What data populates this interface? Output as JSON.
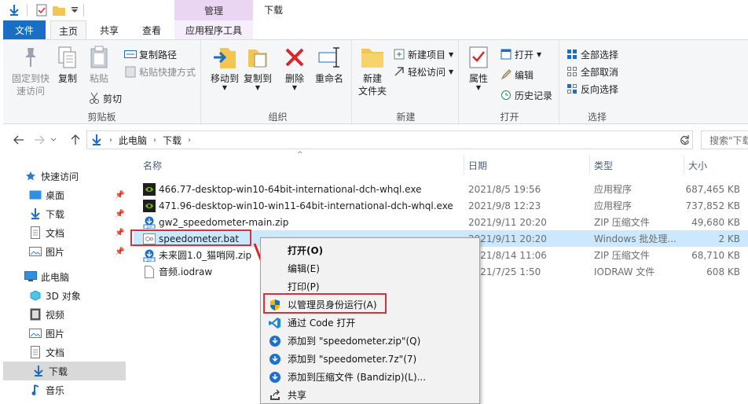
{
  "window": {
    "context_group": "管理",
    "title": "下载"
  },
  "tabs": {
    "file": "文件",
    "home": "主页",
    "share": "共享",
    "view": "查看",
    "app_tools": "应用程序工具"
  },
  "ribbon": {
    "clipboard": {
      "label": "剪贴板",
      "pin_quick_access": "固定到快\n速访问",
      "copy": "复制",
      "paste": "粘贴",
      "copy_path": "复制路径",
      "paste_shortcut": "粘贴快捷方式",
      "cut": "剪切"
    },
    "organize": {
      "label": "组织",
      "move_to": "移动到",
      "copy_to": "复制到",
      "delete": "删除",
      "rename": "重命名"
    },
    "new": {
      "label": "新建",
      "new_folder": "新建\n文件夹",
      "new_item": "新建项目",
      "easy_access": "轻松访问"
    },
    "open": {
      "label": "打开",
      "properties": "属性",
      "open": "打开",
      "edit": "编辑",
      "history": "历史记录"
    },
    "select": {
      "label": "选择",
      "select_all": "全部选择",
      "select_none": "全部取消",
      "invert": "反向选择"
    }
  },
  "address": {
    "path": [
      "此电脑",
      "下载"
    ],
    "search_placeholder": "搜索\"下载"
  },
  "navpane": {
    "quick_access": "快速访问",
    "items": [
      "桌面",
      "下载",
      "文档",
      "图片"
    ],
    "this_pc": "此电脑",
    "pc_items": [
      "3D 对象",
      "视频",
      "图片",
      "文档",
      "下载",
      "音乐"
    ]
  },
  "columns": {
    "name": "名称",
    "date": "日期",
    "type": "类型",
    "size": "大小"
  },
  "files": [
    {
      "name": "466.77-desktop-win10-64bit-international-dch-whql.exe",
      "date": "2021/8/5 19:56",
      "type": "应用程序",
      "size": "687,465 KB",
      "icon": "nvidia-exe-icon"
    },
    {
      "name": "471.96-desktop-win10-win11-64bit-international-dch-whql.exe",
      "date": "2021/9/8 12:23",
      "type": "应用程序",
      "size": "737,852 KB",
      "icon": "nvidia-exe-icon"
    },
    {
      "name": "gw2_speedometer-main.zip",
      "date": "2021/9/11 20:20",
      "type": "ZIP 压缩文件",
      "size": "49,680 KB",
      "icon": "zip-icon"
    },
    {
      "name": "speedometer.bat",
      "date": "2021/9/11 20:20",
      "type": "Windows 批处理...",
      "size": "2 KB",
      "icon": "bat-icon"
    },
    {
      "name": "未来圆1.0_猫哨网.zip",
      "date": "2021/8/14 11:06",
      "type": "ZIP 压缩文件",
      "size": "68,710 KB",
      "icon": "zip-icon"
    },
    {
      "name": "音频.iodraw",
      "date": "2021/7/25 1:50",
      "type": "IODRAW 文件",
      "size": "608 KB",
      "icon": "file-icon"
    }
  ],
  "context_menu": {
    "items": [
      {
        "label": "打开(O)",
        "icon": ""
      },
      {
        "label": "编辑(E)",
        "icon": ""
      },
      {
        "label": "打印(P)",
        "icon": ""
      },
      {
        "label": "以管理员身份运行(A)",
        "icon": "uac-shield-icon"
      },
      {
        "label": "通过 Code 打开",
        "icon": "vscode-icon"
      },
      {
        "label": "添加到 \"speedometer.zip\"(Q)",
        "icon": "bandizip-icon"
      },
      {
        "label": "添加到 \"speedometer.7z\"(7)",
        "icon": "bandizip-icon"
      },
      {
        "label": "添加到压缩文件 (Bandizip)(L)...",
        "icon": "bandizip-icon"
      },
      {
        "label": "共享",
        "icon": "share-icon"
      }
    ]
  },
  "colors": {
    "accent": "#1a6fc4",
    "highlight_red": "#d0343d",
    "selection": "#cce8ff"
  }
}
